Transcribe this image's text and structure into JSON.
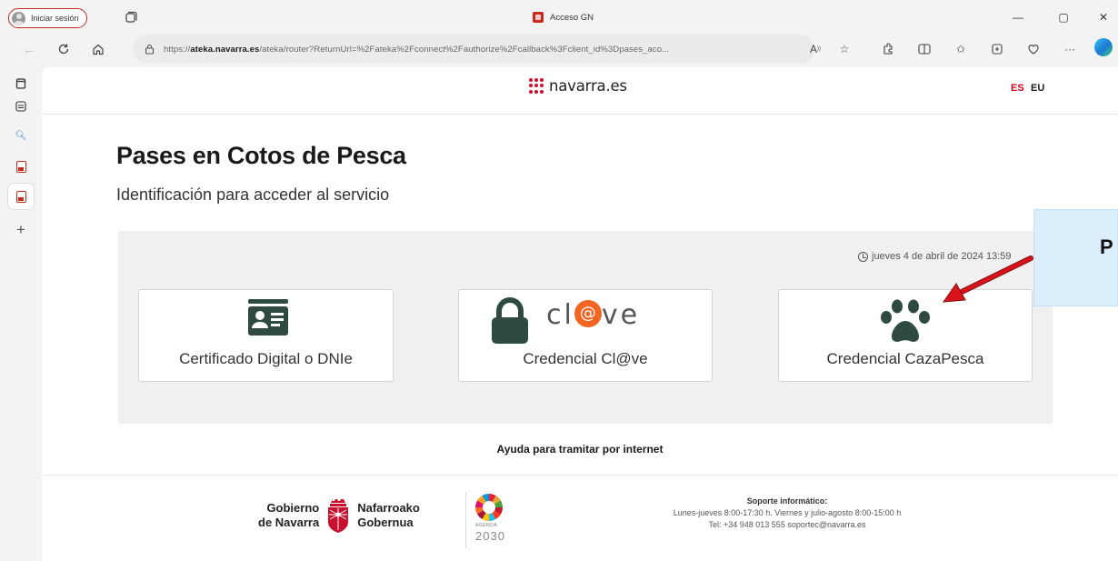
{
  "browser": {
    "signin_label": "Iniciar sesión",
    "tab_title": "Acceso GN",
    "url_prefix": "https://",
    "url_host": "ateka.navarra.es",
    "url_rest": "/ateka/router?ReturnUrl=%2Fateka%2Fconnect%2Fauthorize%2Fcallback%3Fclient_id%3Dpases_aco...",
    "icons": [
      "back-icon",
      "refresh-icon",
      "home-icon",
      "lock-icon",
      "read-aloud-icon",
      "favorite-star-icon",
      "extensions-icon",
      "split-screen-icon",
      "favorites-icon",
      "collections-icon",
      "performance-icon",
      "more-icon",
      "edge-copilot-icon"
    ],
    "window_controls": {
      "minimize": "—",
      "restore": "▢",
      "close": "✕"
    }
  },
  "sidebar": {
    "icons": [
      "tab-actions-icon",
      "vertical-tabs-icon",
      "search-icon",
      "pdf-tab-icon",
      "pdf-tab-active-icon",
      "add-tab-icon"
    ]
  },
  "site": {
    "logo_text": "navarra.es",
    "lang_es": "ES",
    "lang_eu": "EU",
    "title": "Pases en Cotos de Pesca",
    "subtitle": "Identificación para acceder al servicio",
    "datetime": "jueves 4 de abril de 2024 13:59",
    "cards": [
      {
        "label": "Certificado Digital o DNIe",
        "icon": "id-card-icon"
      },
      {
        "label": "Credencial Cl@ve",
        "icon": "clave-lock-icon",
        "brand": "cl@ve"
      },
      {
        "label": "Credencial CazaPesca",
        "icon": "paw-icon"
      }
    ],
    "help_link": "Ayuda para tramitar por internet",
    "footer": {
      "gob_es_1": "Gobierno",
      "gob_es_2": "de Navarra",
      "gob_eu_1": "Nafarroako",
      "gob_eu_2": "Gobernua",
      "agenda_small": "AGENDA",
      "agenda_year": "2030",
      "support_title": "Soporte informático:",
      "support_hours": "Lunes-jueves 8:00-17:30 h. Viernes y julio-agosto 8:00-15:00 h",
      "support_contact": "Tel: +34 948 013 555 soportec@navarra.es"
    }
  },
  "annotation": {
    "callout_letter": "P",
    "arrow_color": "#d9141b"
  },
  "colors": {
    "brand_red": "#c8102e",
    "card_icon": "#2e4a43",
    "clave_orange": "#f26522"
  }
}
